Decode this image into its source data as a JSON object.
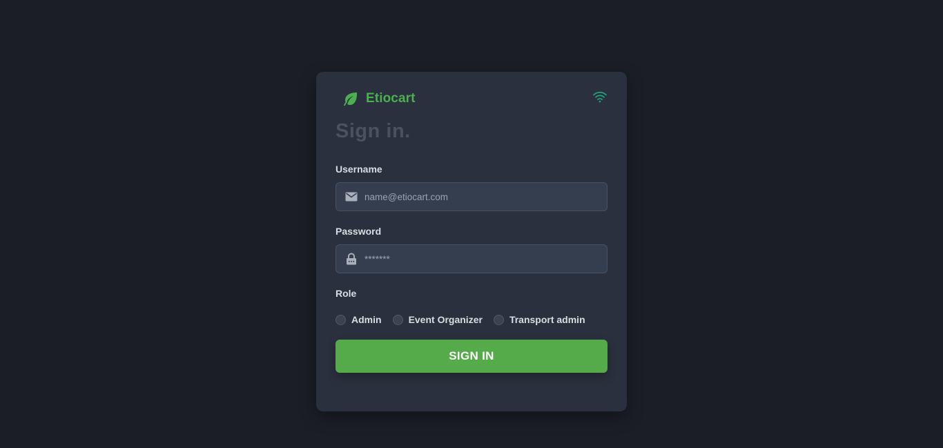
{
  "brand": {
    "name": "Etiocart",
    "icon": "leaf-icon",
    "color": "#4caf50"
  },
  "status_icon": "wifi-icon",
  "form": {
    "title": "Sign in.",
    "username": {
      "label": "Username",
      "placeholder": "name@etiocart.com",
      "value": "",
      "icon": "envelope-icon"
    },
    "password": {
      "label": "Password",
      "placeholder": "*******",
      "value": "",
      "icon": "lock-icon"
    },
    "role": {
      "label": "Role",
      "options": [
        "Admin",
        "Event Organizer",
        "Transport admin"
      ],
      "selected": null
    },
    "submit_label": "SIGN IN",
    "submit_color": "#55aa4a"
  },
  "colors": {
    "background": "#1b1e26",
    "card": "#2a303d",
    "input": "#343e4f",
    "wifi": "#1fa37a"
  }
}
